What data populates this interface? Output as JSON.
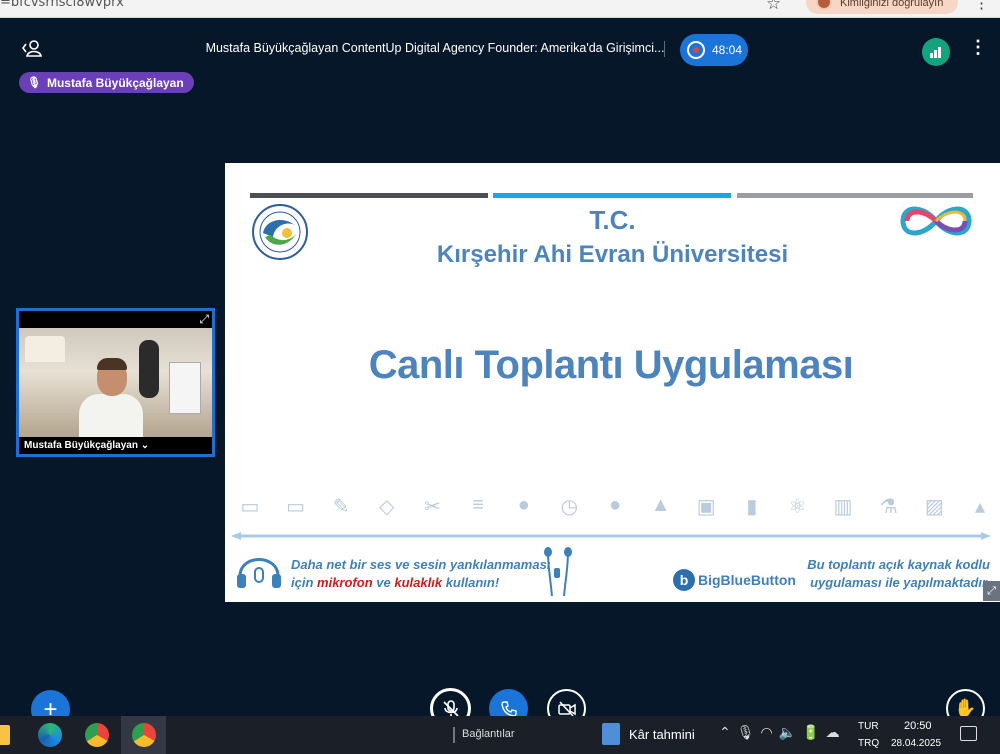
{
  "browser": {
    "url_fragment": "=bfcvsrhsci8wvprx",
    "verify_label": "Kimliğinizi doğrulayın"
  },
  "meeting": {
    "title": "Mustafa Büyükçağlayan ContentUp Digital Agency Founder: Amerika'da Girişimci...",
    "recording_time": "48:04",
    "talking_indicator": "Mustafa Büyükçağlayan"
  },
  "webcam": {
    "user_name": "Mustafa Büyükçağlayan",
    "user_menu_caret": "⌄"
  },
  "slide": {
    "tc": "T.C.",
    "university": "Kırşehir Ahi Evran Üniversitesi",
    "heading": "Canlı Toplantı Uygulaması",
    "left_note_line1": "Daha net bir ses ve sesin yankılanmaması",
    "left_note_pre": "için",
    "left_note_mic": "mikrofon",
    "left_note_and": "ve",
    "left_note_headphone": "kulaklık",
    "left_note_post": "kullanın!",
    "right_note_line1": "Bu toplantı açık kaynak kodlu",
    "right_note_line2": "uygulaması ile yapılmaktadır.",
    "bbb_letter": "b",
    "bbb_name": "BigBlueButton",
    "bar_colors": [
      "#4b4f54",
      "#1ea4e0",
      "#9a9ea3"
    ],
    "text_color": "#4d84bd",
    "icons": [
      "tablet-icon",
      "laptop-icon",
      "pencil-icon",
      "eraser-icon",
      "scissors-icon",
      "books-icon",
      "globe-icon",
      "clock-icon",
      "globe-stand-icon",
      "bell-icon",
      "backpack-icon",
      "paint-cup-icon",
      "atom-icon",
      "abacus-icon",
      "microscope-icon",
      "teacher-board-icon",
      "graduation-cap-icon"
    ],
    "icon_glyphs": [
      "▭",
      "▭",
      "✎",
      "◇",
      "✂",
      "≡",
      "●",
      "◷",
      "●",
      "▲",
      "▣",
      "▮",
      "⚛",
      "▥",
      "⚗",
      "▨",
      "▴"
    ]
  },
  "controls": {
    "actions": "+",
    "mute_state": "muted",
    "video_state": "off"
  },
  "taskbar": {
    "links_label": "Bağlantılar",
    "weather_text": "Kâr tahmini",
    "lang_top": "TUR",
    "lang_bottom": "TRQ",
    "time": "20:50",
    "date": "28.04.2025"
  },
  "colors": {
    "app_bg": "#06172a",
    "accent_blue": "#1b74d8",
    "talker_purple": "#6a3fb8",
    "connection_green": "#14a37f"
  }
}
